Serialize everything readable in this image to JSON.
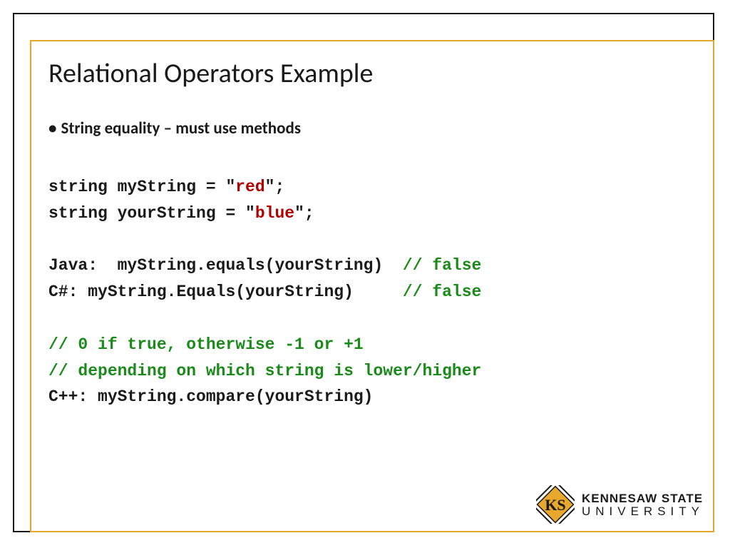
{
  "title": "Relational Operators Example",
  "bullet": "String equality – must use methods",
  "code": {
    "line1_a": "string myString = \"",
    "line1_b": "red",
    "line1_c": "\";",
    "line2_a": "string yourString = \"",
    "line2_b": "blue",
    "line2_c": "\";",
    "java_label": "Java:  ",
    "java_call": "myString.equals(yourString)  ",
    "java_comment": "// false",
    "cs_label": "C#: ",
    "cs_call": "myString.Equals(yourString)     ",
    "cs_comment": "// false",
    "cmt1": "// 0 if true, otherwise -1 or +1",
    "cmt2": "// depending on which string is lower/higher",
    "cpp_label": "C++: ",
    "cpp_call": "myString.compare(yourString)"
  },
  "logo": {
    "top": "KENNESAW STATE",
    "bottom": "UNIVERSITY"
  }
}
